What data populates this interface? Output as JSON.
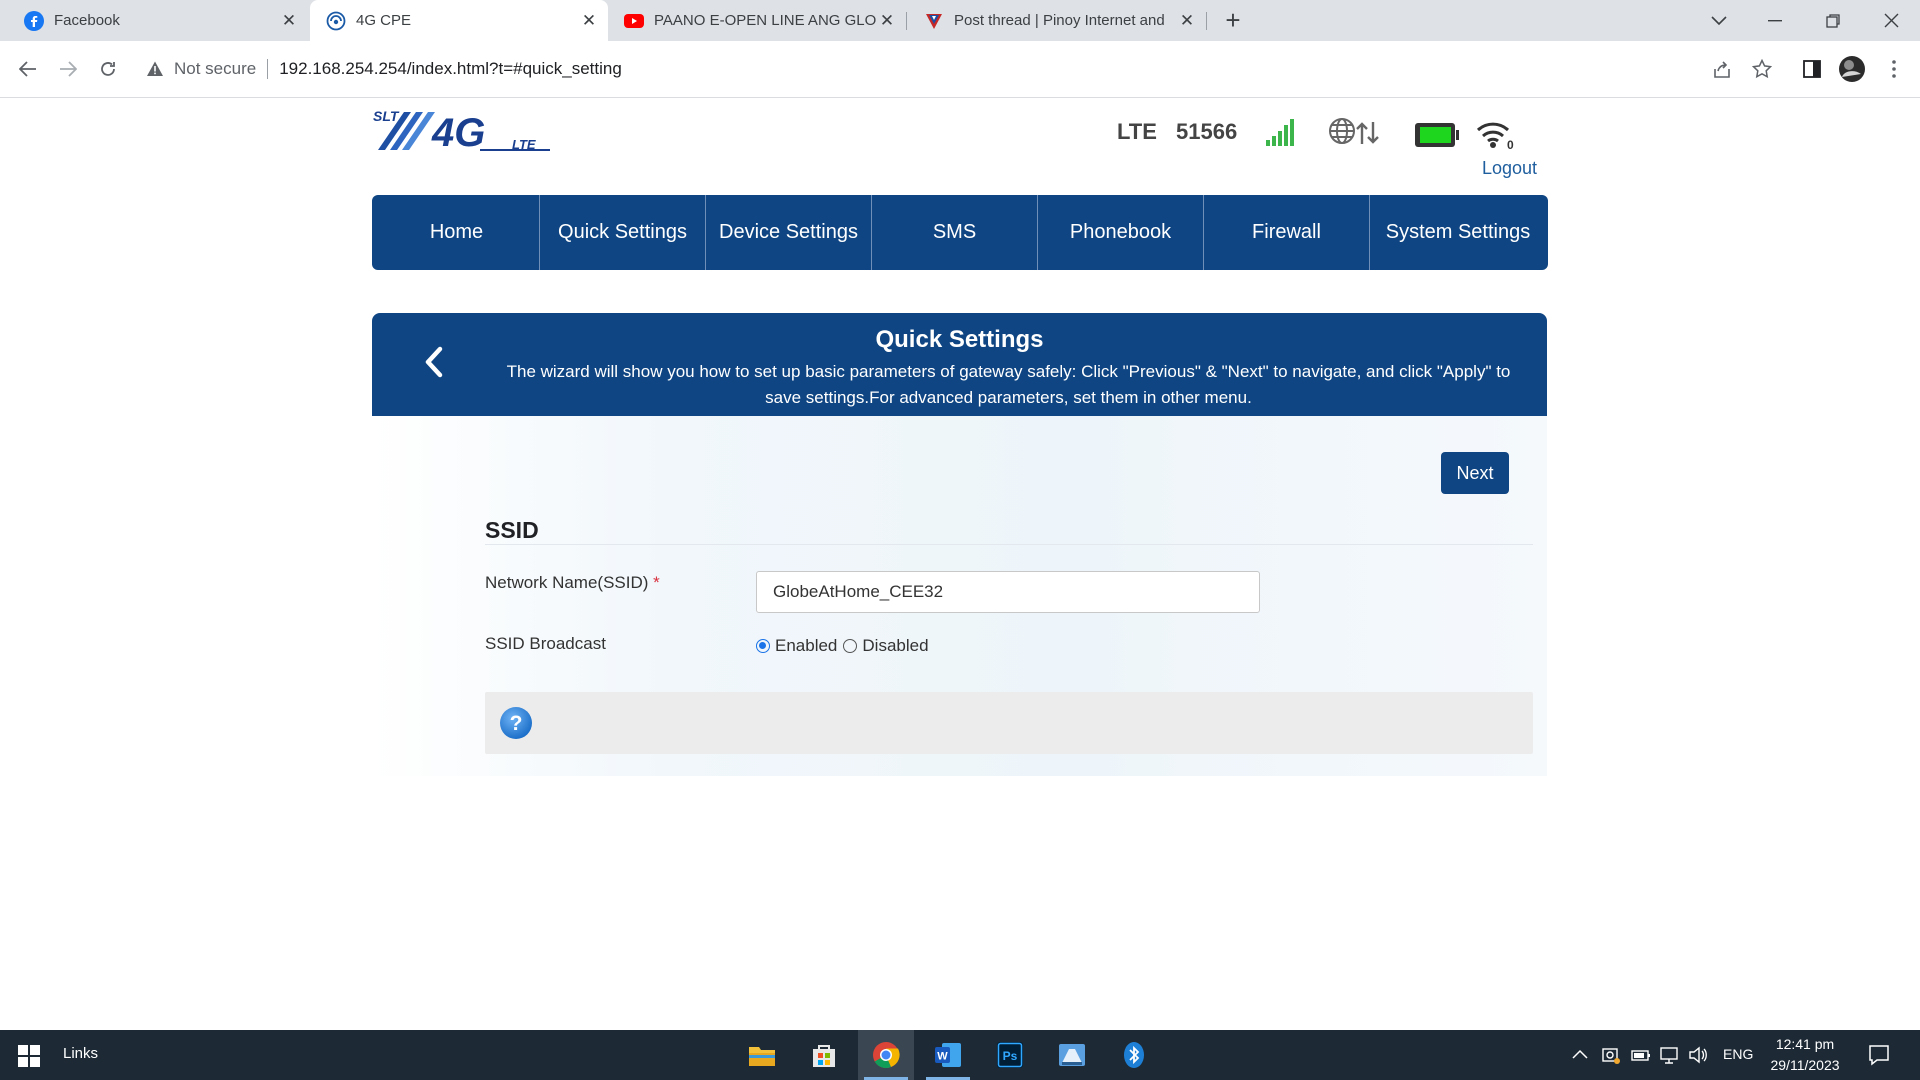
{
  "browser": {
    "tabs": [
      {
        "title": "Facebook",
        "icon": "facebook-icon"
      },
      {
        "title": "4G CPE",
        "icon": "globe-icon",
        "active": true
      },
      {
        "title": "PAANO E-OPEN LINE ANG GLOE",
        "icon": "youtube-icon"
      },
      {
        "title": "Post thread | Pinoy Internet and",
        "icon": "forum-icon"
      }
    ],
    "security_label": "Not secure",
    "url": "192.168.254.254/index.html?t=#quick_setting"
  },
  "header": {
    "network_type": "LTE",
    "network_code": "51566",
    "logout_label": "Logout"
  },
  "nav": {
    "items": [
      "Home",
      "Quick Settings",
      "Device Settings",
      "SMS",
      "Phonebook",
      "Firewall",
      "System Settings"
    ]
  },
  "panel": {
    "title": "Quick Settings",
    "description": "The wizard will show you how to set up basic parameters of gateway safely: Click \"Previous\" & \"Next\" to navigate, and click \"Apply\" to save settings.For advanced parameters, set them in other menu.",
    "next_label": "Next",
    "section_title": "SSID",
    "ssid_label": "Network Name(SSID)",
    "required_mark": "*",
    "ssid_value": "GlobeAtHome_CEE32",
    "broadcast_label": "SSID Broadcast",
    "broadcast_options": [
      "Enabled",
      "Disabled"
    ],
    "broadcast_selected": "Enabled"
  },
  "taskbar": {
    "links_label": "Links",
    "language": "ENG",
    "time": "12:41 pm",
    "date": "29/11/2023"
  },
  "colors": {
    "primary": "#0f4582",
    "tab_strip": "#dee1e6",
    "taskbar": "#1d2a35"
  }
}
